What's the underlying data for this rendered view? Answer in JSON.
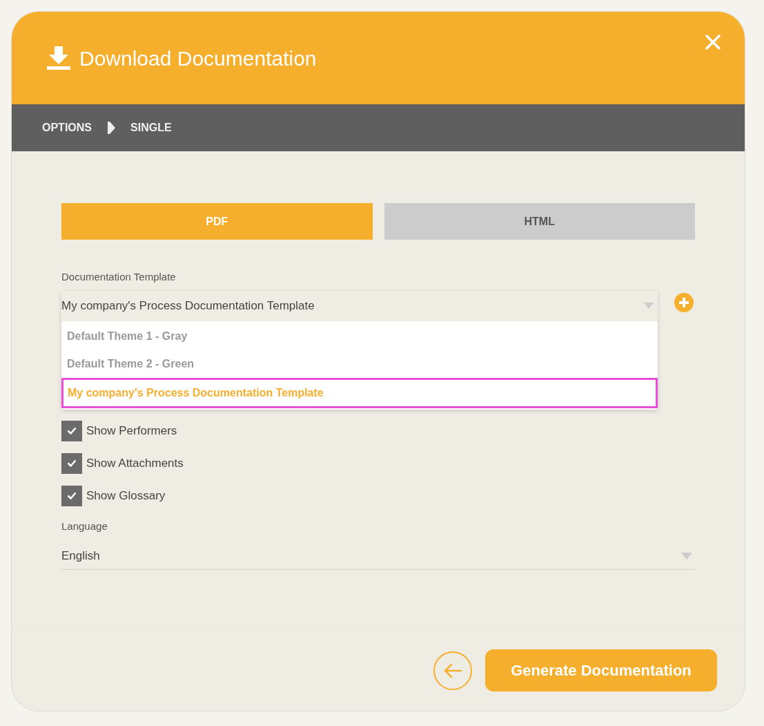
{
  "dialog": {
    "title": "Download Documentation"
  },
  "breadcrumb": [
    "OPTIONS",
    "SINGLE"
  ],
  "tabs": [
    {
      "label": "PDF",
      "selected": true
    },
    {
      "label": "HTML",
      "selected": false
    }
  ],
  "template": {
    "label": "Documentation Template",
    "value": "My company's Process Documentation Template",
    "expanded": true,
    "options": [
      {
        "label": "Default Theme 1 - Gray",
        "selected": false
      },
      {
        "label": "Default Theme 2 - Green",
        "selected": false
      },
      {
        "label": "My company's Process Documentation Template",
        "selected": true
      }
    ]
  },
  "checkboxes": [
    {
      "label": "Show Performers",
      "checked": true
    },
    {
      "label": "Show Attachments",
      "checked": true
    },
    {
      "label": "Show Glossary",
      "checked": true
    }
  ],
  "language": {
    "label": "Language",
    "value": "English"
  },
  "buttons": {
    "generate": "Generate Documentation"
  }
}
